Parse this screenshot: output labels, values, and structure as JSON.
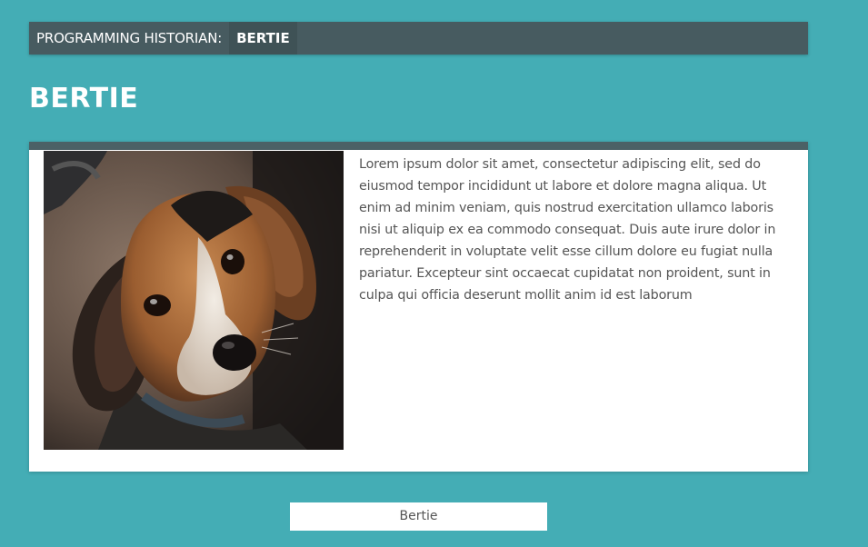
{
  "header": {
    "site_name": "PROGRAMMING HISTORIAN:",
    "breadcrumb": "BERTIE"
  },
  "page": {
    "title": "BERTIE"
  },
  "card": {
    "image_alt": "Photo of a beagle dog looking up",
    "text": "Lorem ipsum dolor sit amet, consectetur adipiscing elit, sed do eiusmod tempor incididunt ut labore et dolore magna aliqua. Ut enim ad minim veniam, quis nostrud exercitation ullamco laboris nisi ut aliquip ex ea commodo consequat. Duis aute irure dolor in reprehenderit in voluptate velit esse cillum dolore eu fugiat nulla pariatur. Excepteur sint occaecat cupidatat non proident, sunt in culpa qui officia deserunt mollit anim id est laborum"
  },
  "footer": {
    "button_label": "Bertie"
  },
  "colors": {
    "background": "#44adb5",
    "topbar": "#475b60",
    "card_border": "#4b6166"
  }
}
